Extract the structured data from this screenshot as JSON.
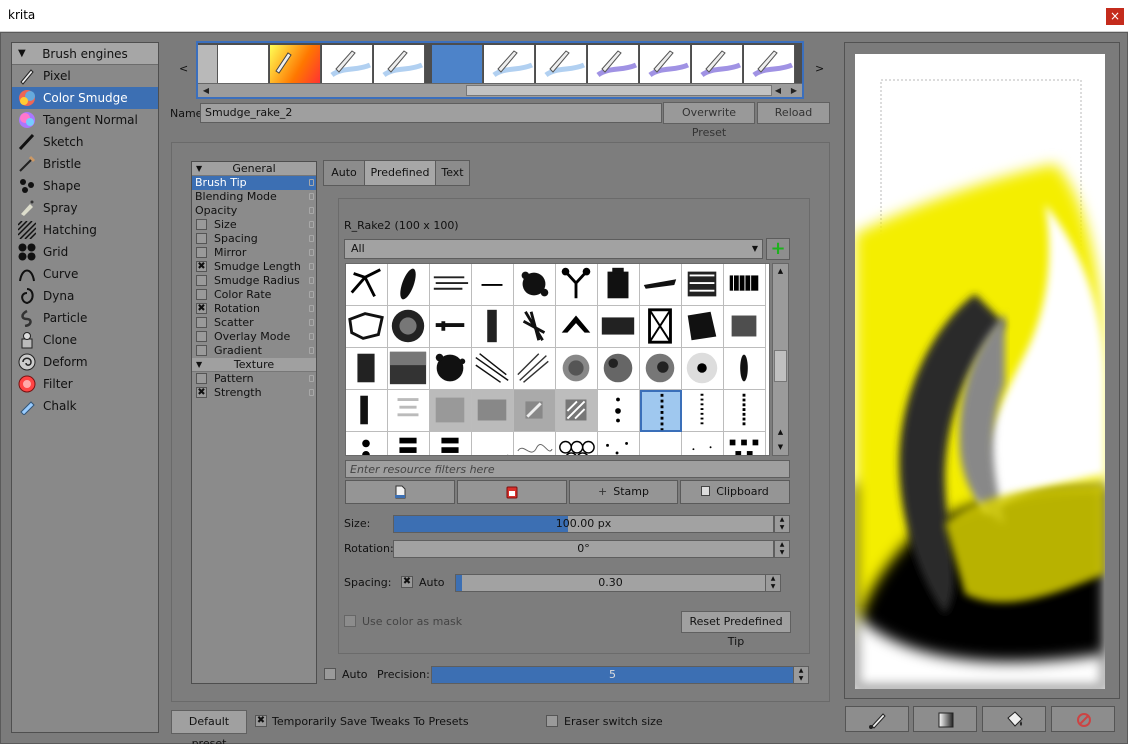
{
  "window": {
    "title": "krita",
    "close": "×"
  },
  "engines": {
    "header": "Brush engines",
    "items": [
      {
        "label": "Pixel",
        "icon": "pixel-brush-icon"
      },
      {
        "label": "Color Smudge",
        "icon": "color-smudge-icon",
        "selected": true
      },
      {
        "label": "Tangent Normal",
        "icon": "tangent-normal-icon"
      },
      {
        "label": "Sketch",
        "icon": "sketch-icon"
      },
      {
        "label": "Bristle",
        "icon": "bristle-icon"
      },
      {
        "label": "Shape",
        "icon": "shape-icon"
      },
      {
        "label": "Spray",
        "icon": "spray-icon"
      },
      {
        "label": "Hatching",
        "icon": "hatching-icon"
      },
      {
        "label": "Grid",
        "icon": "grid-icon"
      },
      {
        "label": "Curve",
        "icon": "curve-icon"
      },
      {
        "label": "Dyna",
        "icon": "dyna-icon"
      },
      {
        "label": "Particle",
        "icon": "particle-icon"
      },
      {
        "label": "Clone",
        "icon": "clone-icon"
      },
      {
        "label": "Deform",
        "icon": "deform-icon"
      },
      {
        "label": "Filter",
        "icon": "filter-icon"
      },
      {
        "label": "Chalk",
        "icon": "chalk-icon"
      }
    ]
  },
  "presets": {
    "prev": "<",
    "next": ">",
    "name_label": "Name:",
    "name_value": "Smudge_rake_2",
    "overwrite": "Overwrite Preset",
    "reload": "Reload"
  },
  "options": {
    "general_header": "General",
    "texture_header": "Texture",
    "general_items": [
      {
        "label": "Brush Tip",
        "cb": null,
        "selected": true
      },
      {
        "label": "Blending Mode",
        "cb": null
      },
      {
        "label": "Opacity",
        "cb": null
      },
      {
        "label": "Size",
        "cb": false
      },
      {
        "label": "Spacing",
        "cb": false
      },
      {
        "label": "Mirror",
        "cb": false
      },
      {
        "label": "Smudge Length",
        "cb": true
      },
      {
        "label": "Smudge Radius",
        "cb": false
      },
      {
        "label": "Color Rate",
        "cb": false
      },
      {
        "label": "Rotation",
        "cb": true
      },
      {
        "label": "Scatter",
        "cb": false
      },
      {
        "label": "Overlay Mode",
        "cb": false
      },
      {
        "label": "Gradient",
        "cb": false
      }
    ],
    "texture_items": [
      {
        "label": "Pattern",
        "cb": false
      },
      {
        "label": "Strength",
        "cb": true
      }
    ]
  },
  "tip": {
    "tabs": [
      "Auto",
      "Predefined",
      "Text"
    ],
    "active_tab": "Predefined",
    "name": "R_Rake2 (100 x 100)",
    "filter_combo": "All",
    "filter_placeholder": "Enter resource filters here",
    "stamp": "Stamp",
    "clipboard": "Clipboard",
    "size_label": "Size:",
    "size_value": "100.00 px",
    "size_fraction": 0.46,
    "rotation_label": "Rotation:",
    "rotation_value": "0°",
    "spacing_label": "Spacing:",
    "spacing_auto": "Auto",
    "spacing_value": "0.30",
    "spacing_fraction": 0.02,
    "use_color_mask": "Use color as mask",
    "reset": "Reset Predefined Tip",
    "precision_auto": "Auto",
    "precision_label": "Precision:",
    "precision_value": "5"
  },
  "footer": {
    "default_preset": "Default preset",
    "temp_save": "Temporarily Save Tweaks To Presets",
    "eraser_switch": "Eraser switch size"
  },
  "colors": {
    "accent": "#3c6fb3",
    "yellow": "#f4ee00"
  }
}
